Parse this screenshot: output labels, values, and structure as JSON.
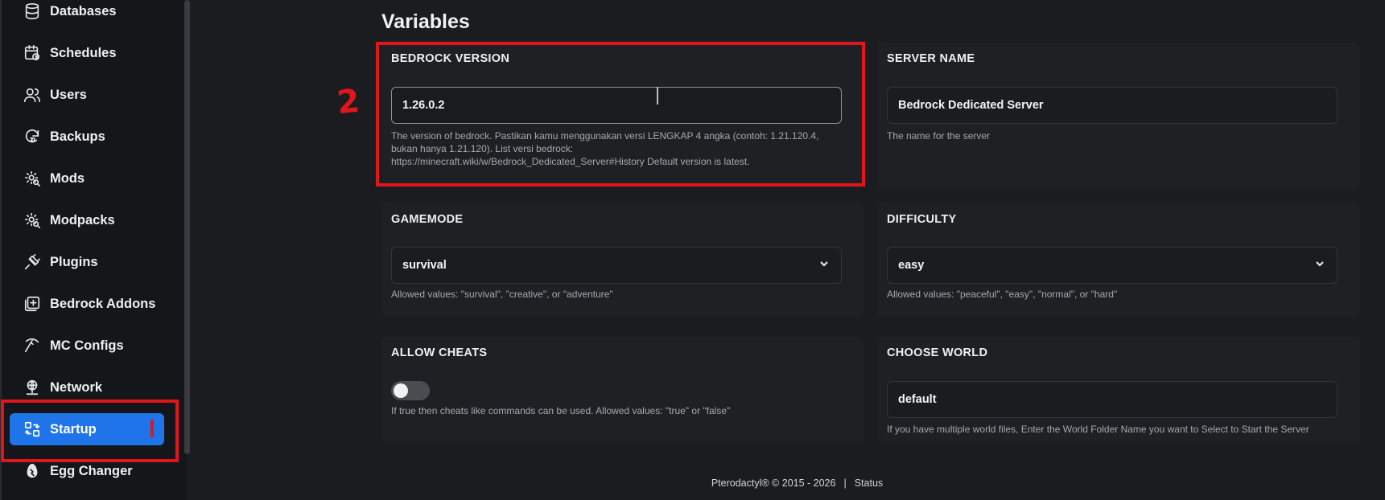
{
  "sidebar": {
    "items": [
      {
        "label": "Databases",
        "icon": "database-icon"
      },
      {
        "label": "Schedules",
        "icon": "calendar-clock-icon"
      },
      {
        "label": "Users",
        "icon": "users-icon"
      },
      {
        "label": "Backups",
        "icon": "backup-icon"
      },
      {
        "label": "Mods",
        "icon": "gear-search-icon"
      },
      {
        "label": "Modpacks",
        "icon": "gear-search-icon"
      },
      {
        "label": "Plugins",
        "icon": "plug-icon"
      },
      {
        "label": "Bedrock Addons",
        "icon": "square-plus-icon"
      },
      {
        "label": "MC Configs",
        "icon": "pickaxe-icon"
      },
      {
        "label": "Network",
        "icon": "globe-network-icon"
      },
      {
        "label": "Startup",
        "icon": "switch-arrows-icon",
        "active": true
      },
      {
        "label": "Egg Changer",
        "icon": "egg-icon"
      }
    ]
  },
  "annotations": {
    "step_number": "2"
  },
  "main": {
    "title": "Variables",
    "variables": [
      {
        "label": "BEDROCK VERSION",
        "value": "1.26.0.2",
        "description_lines": [
          "The version of bedrock. Pastikan kamu menggunakan versi LENGKAP 4 angka (contoh: 1.21.120.4,",
          "bukan hanya 1.21.120). List versi bedrock:",
          "https://minecraft.wiki/w/Bedrock_Dedicated_Server#History Default version is latest."
        ]
      },
      {
        "label": "SERVER NAME",
        "value": "Bedrock Dedicated Server",
        "description": "The name for the server"
      },
      {
        "label": "GAMEMODE",
        "value": "survival",
        "description": "Allowed values: \"survival\", \"creative\", or \"adventure\""
      },
      {
        "label": "DIFFICULTY",
        "value": "easy",
        "description": "Allowed values: \"peaceful\", \"easy\", \"normal\", or \"hard\""
      },
      {
        "label": "ALLOW CHEATS",
        "value": false,
        "description": "If true then cheats like commands can be used. Allowed values: \"true\" or \"false\""
      },
      {
        "label": "CHOOSE WORLD",
        "value": "default",
        "description": "If you have multiple world files, Enter the World Folder Name you want to Select to Start the Server"
      }
    ]
  },
  "footer": {
    "copyright": "Pterodactyl® © 2015 - 2026",
    "separator": "|",
    "status_link": "Status"
  },
  "colors": {
    "accent": "#1e74e8",
    "annotation_red": "#e0161c"
  }
}
